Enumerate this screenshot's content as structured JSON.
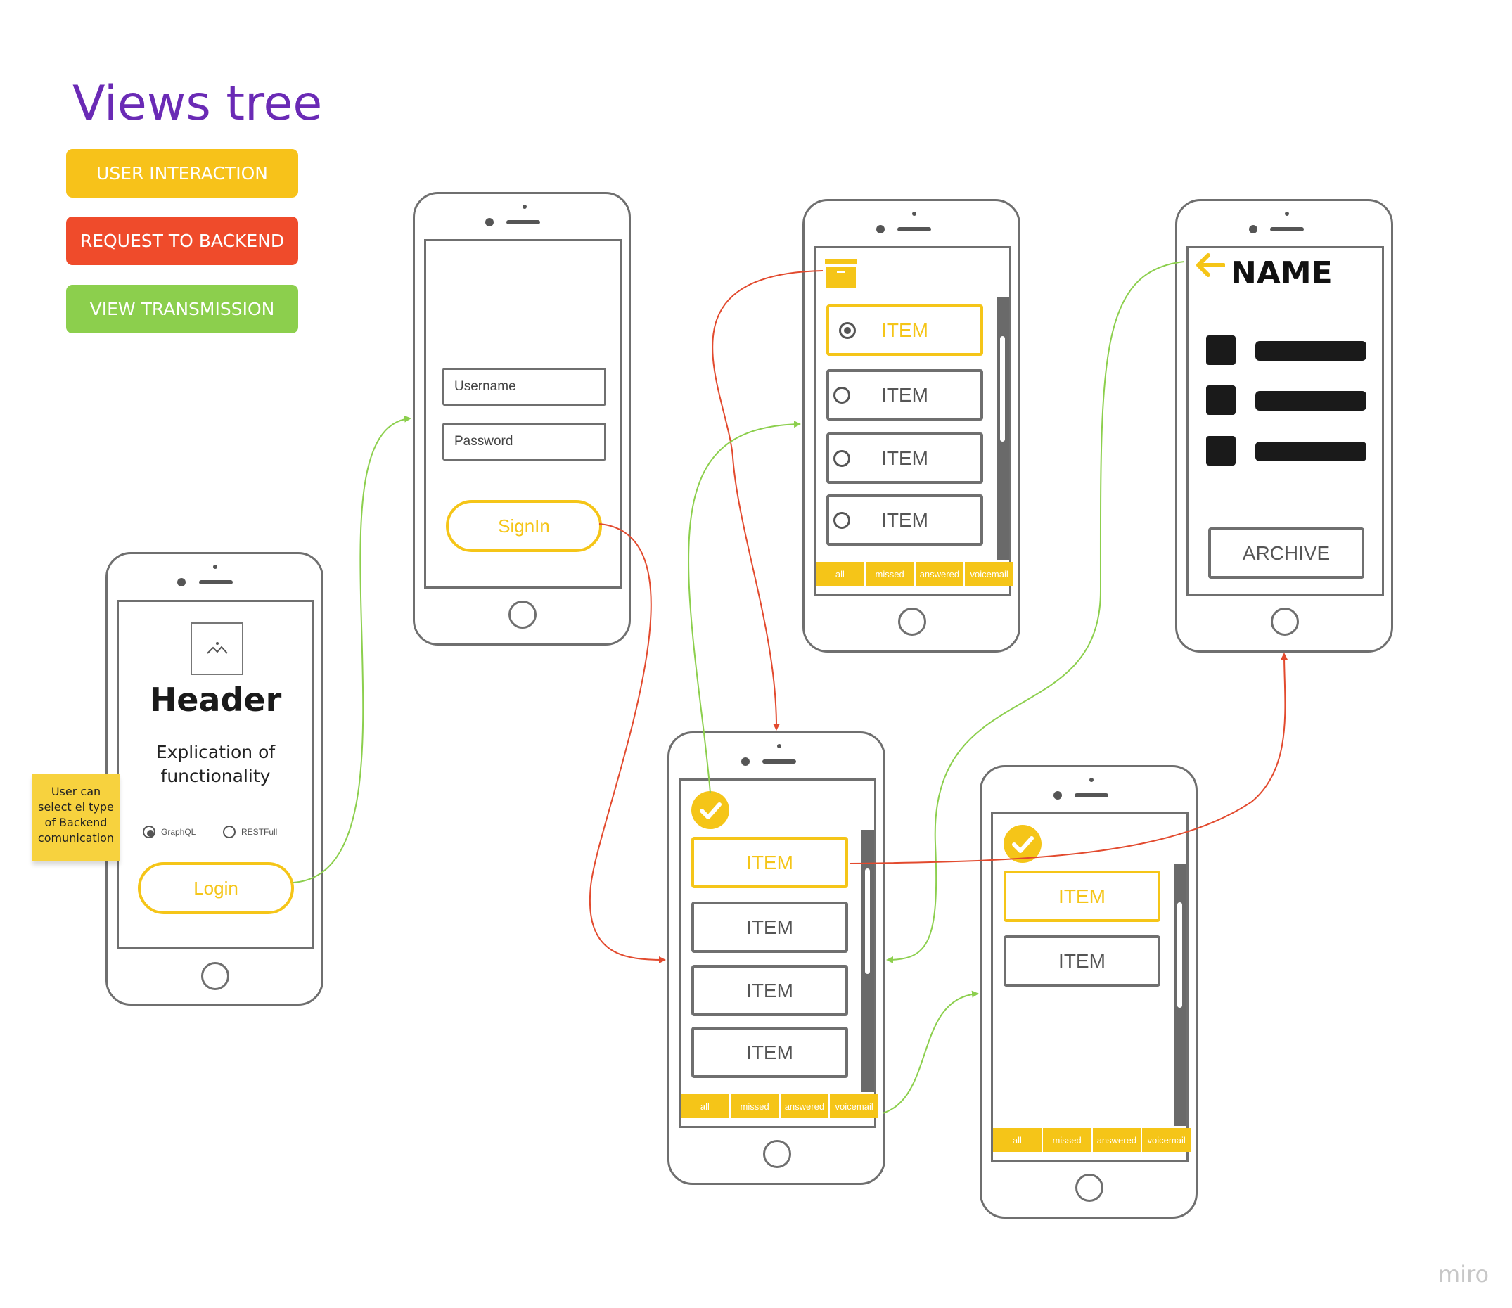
{
  "title": "Views tree",
  "legend": [
    {
      "label": "USER INTERACTION",
      "color": "#f7c21a"
    },
    {
      "label": "REQUEST TO BACKEND",
      "color": "#ef4b2b"
    },
    {
      "label": "VIEW TRANSMISSION",
      "color": "#8ccf4d"
    }
  ],
  "sticky_note": "User can select el type of Backend comunication",
  "screen_welcome": {
    "image_icon": "image-placeholder-icon",
    "header": "Header",
    "explication_line1": "Explication of",
    "explication_line2": "functionality",
    "option_graphql": "GraphQL",
    "option_restfull": "RESTFull",
    "login": "Login"
  },
  "screen_login": {
    "username_placeholder": "Username",
    "password_placeholder": "Password",
    "signin": "SignIn"
  },
  "screen_radio_list": {
    "archive_icon": "archive-box-icon",
    "items": [
      "ITEM",
      "ITEM",
      "ITEM",
      "ITEM"
    ],
    "tabs": [
      "all",
      "missed",
      "answered",
      "voicemail"
    ]
  },
  "screen_list": {
    "check_icon": "check-circle-icon",
    "items": [
      "ITEM",
      "ITEM",
      "ITEM",
      "ITEM"
    ],
    "tabs": [
      "all",
      "missed",
      "answered",
      "voicemail"
    ]
  },
  "screen_list_short": {
    "check_icon": "check-circle-icon",
    "items": [
      "ITEM",
      "ITEM"
    ],
    "tabs": [
      "all",
      "missed",
      "answered",
      "voicemail"
    ]
  },
  "screen_detail": {
    "back_icon": "arrow-left-icon",
    "name": "NAME",
    "archive": "ARCHIVE"
  },
  "watermark": "miro",
  "colors": {
    "accent": "#f5c518",
    "request": "#e24a2e",
    "transmission": "#8ccf4d",
    "title": "#6a2ab5"
  }
}
